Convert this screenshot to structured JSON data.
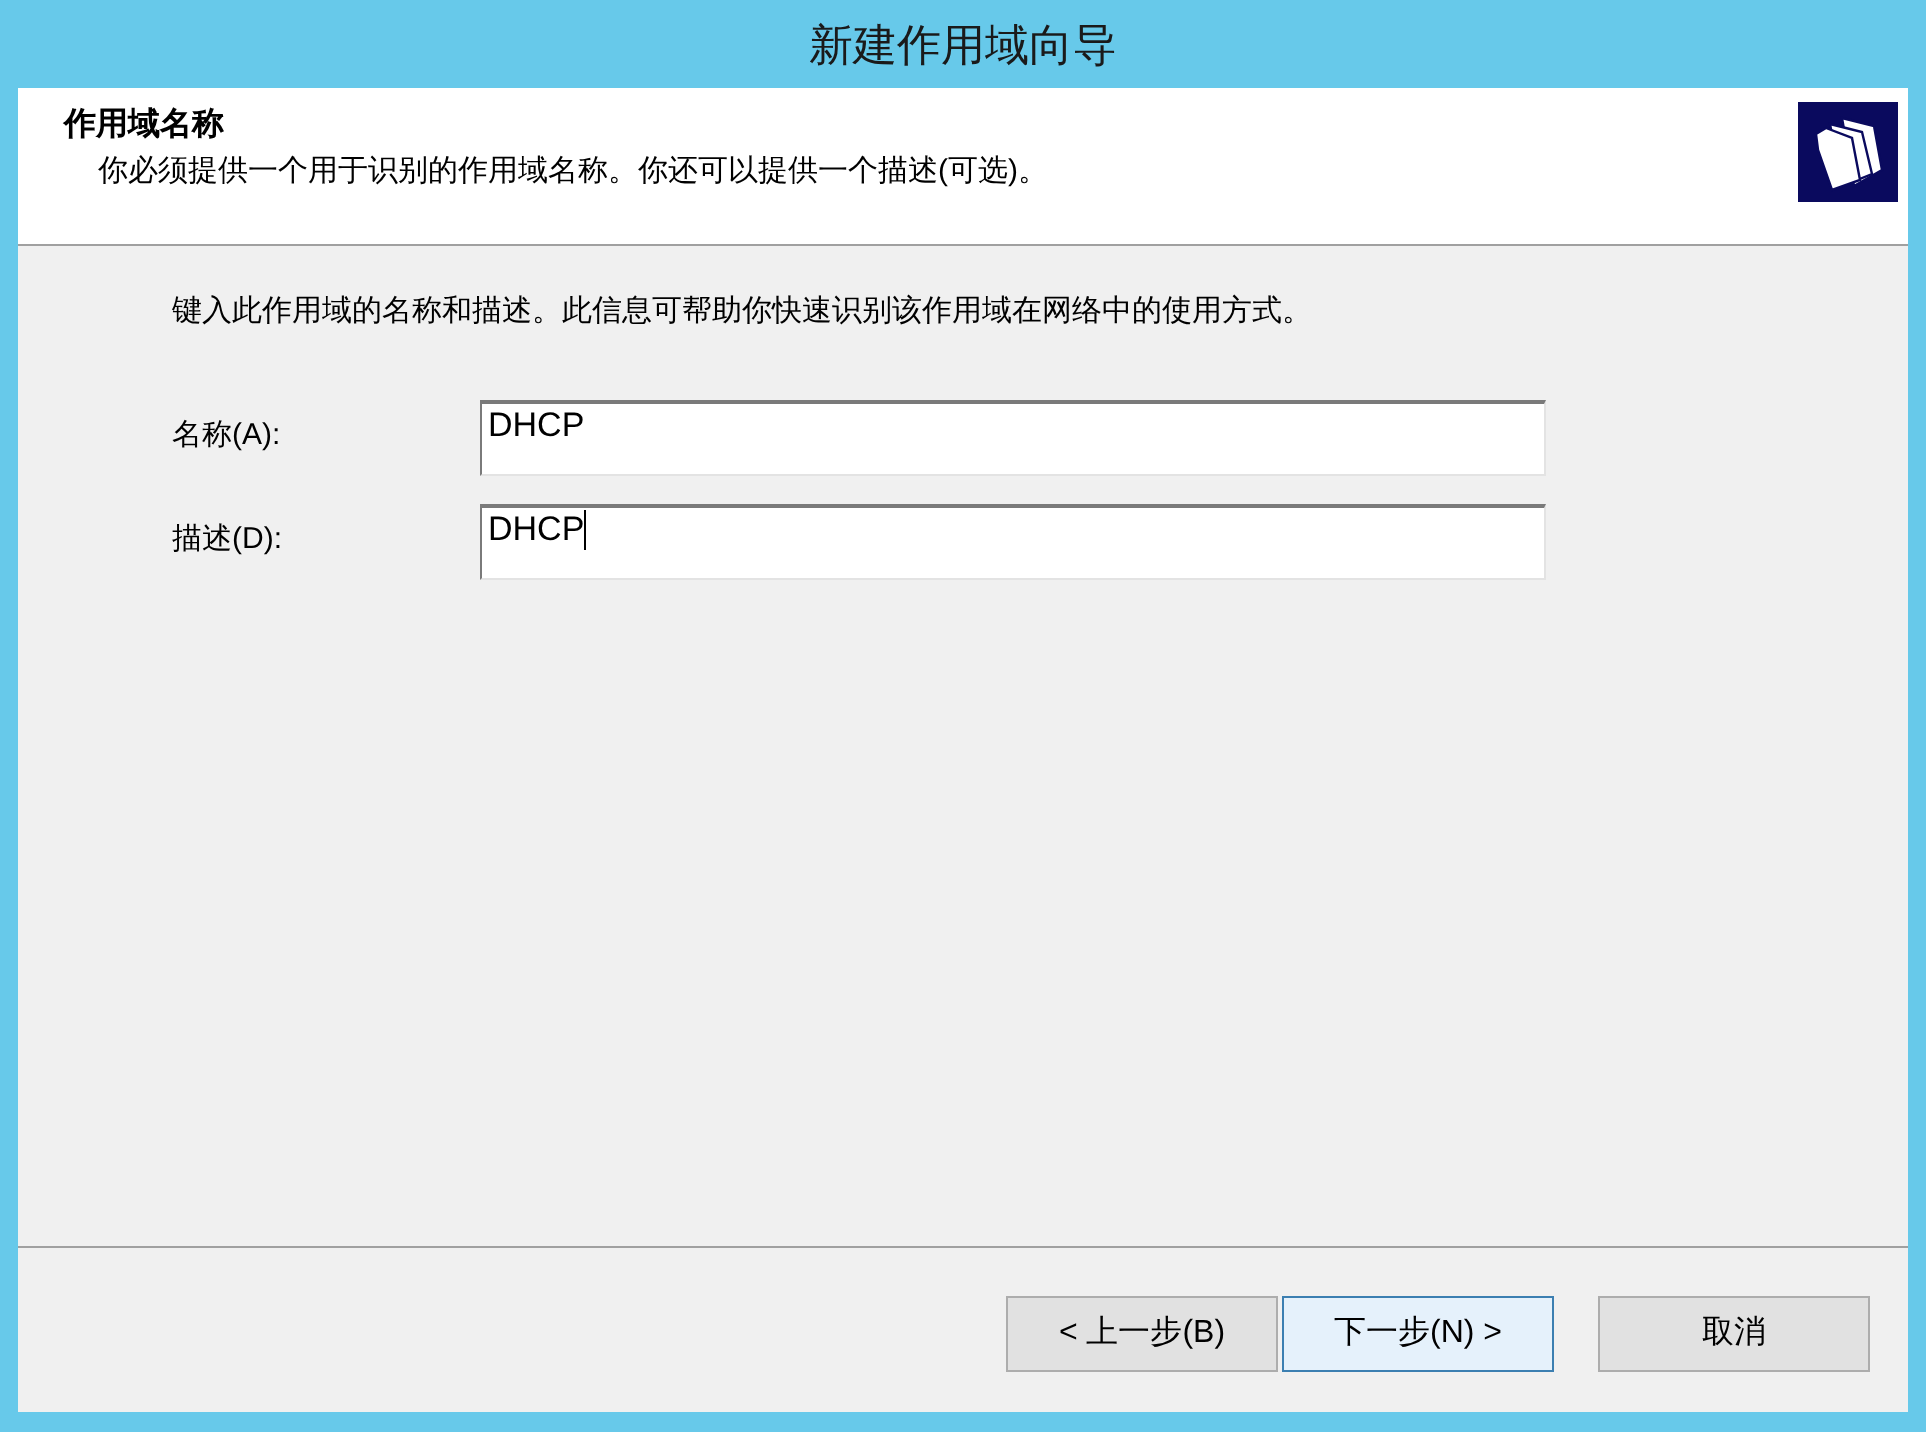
{
  "window": {
    "title": "新建作用域向导"
  },
  "header": {
    "title": "作用域名称",
    "subtitle": "你必须提供一个用于识别的作用域名称。你还可以提供一个描述(可选)。"
  },
  "instruction": "键入此作用域的名称和描述。此信息可帮助你快速识别该作用域在网络中的使用方式。",
  "fields": [
    {
      "label": "名称(A):",
      "value": "DHCP",
      "focused": false
    },
    {
      "label": "描述(D):",
      "value": "DHCP",
      "focused": true
    }
  ],
  "buttons": [
    {
      "label": "< 上一步(B)",
      "default": false
    },
    {
      "label": "下一步(N) >",
      "default": true
    },
    {
      "label": "取消",
      "default": false
    }
  ]
}
